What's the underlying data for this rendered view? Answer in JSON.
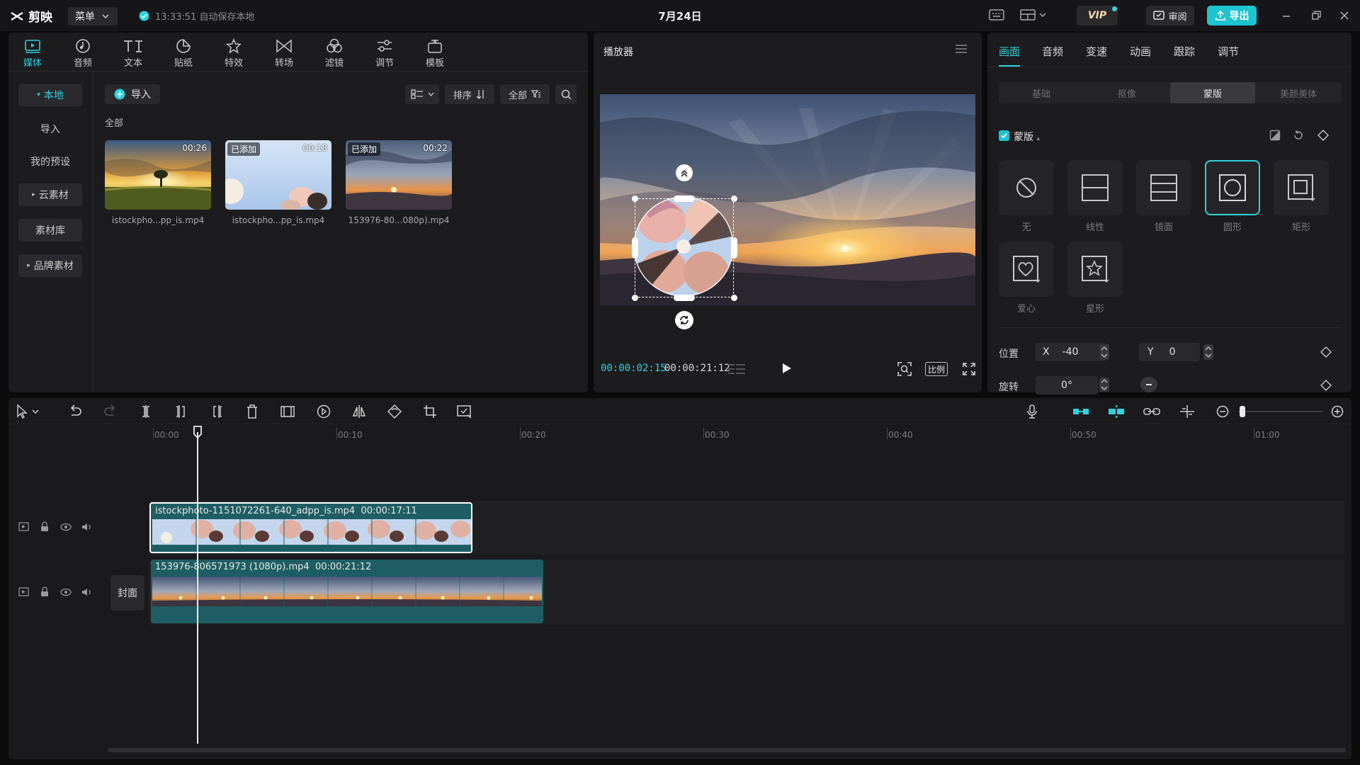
{
  "app": {
    "name": "剪映",
    "menu_label": "菜单",
    "autosave": "13:33:51 自动保存本地",
    "project_title": "7月24日",
    "vip_label": "VIP",
    "review_label": "审阅",
    "export_label": "导出"
  },
  "media_tools": [
    {
      "label": "媒体",
      "icon": "media-icon"
    },
    {
      "label": "音频",
      "icon": "audio-icon"
    },
    {
      "label": "文本",
      "icon": "text-icon"
    },
    {
      "label": "贴纸",
      "icon": "sticker-icon"
    },
    {
      "label": "特效",
      "icon": "effects-icon"
    },
    {
      "label": "转场",
      "icon": "transition-icon"
    },
    {
      "label": "滤镜",
      "icon": "filter-icon"
    },
    {
      "label": "调节",
      "icon": "adjust-icon"
    },
    {
      "label": "模板",
      "icon": "template-icon"
    }
  ],
  "sidebar": {
    "local": "本地",
    "import": "导入",
    "presets": "我的预设",
    "cloud": "云素材",
    "library": "素材库",
    "brand": "品牌素材"
  },
  "media": {
    "import_label": "导入",
    "sort_label": "排序",
    "filter_label": "全部",
    "all_label": "全部",
    "items": [
      {
        "name": "istockpho...pp_is.mp4",
        "duration": "00:26",
        "tag": ""
      },
      {
        "name": "istockpho...pp_is.mp4",
        "duration": "00:18",
        "tag": "已添加"
      },
      {
        "name": "153976-80...080p).mp4",
        "duration": "00:22",
        "tag": "已添加"
      }
    ]
  },
  "player": {
    "title": "播放器",
    "current_time": "00:00:02:15",
    "total_time": "00:00:21:12",
    "ratio_label": "比例"
  },
  "props": {
    "tabs": [
      "画面",
      "音频",
      "变速",
      "动画",
      "跟踪",
      "调节"
    ],
    "segments": [
      "基础",
      "抠像",
      "蒙版",
      "美颜美体"
    ],
    "mask_label": "蒙版",
    "masks": [
      "无",
      "线性",
      "镜面",
      "圆形",
      "矩形",
      "爱心",
      "星形"
    ],
    "position_label": "位置",
    "x_label": "X",
    "x_value": "-40",
    "y_label": "Y",
    "y_value": "0",
    "rotation_label": "旋转",
    "rotation_value": "0°"
  },
  "timeline": {
    "ruler": [
      "00:00",
      "00:10",
      "00:20",
      "00:30",
      "00:40",
      "00:50",
      "01:00"
    ],
    "cover_label": "封面",
    "clips": [
      {
        "label": "istockphoto-1151072261-640_adpp_is.mp4",
        "duration": "00:00:17:11"
      },
      {
        "label": "153976-806571973 (1080p).mp4",
        "duration": "00:00:21:12"
      }
    ]
  },
  "colors": {
    "accent": "#2ed1dc",
    "export": "#1ec4cf",
    "clip_teal": "#1e5e63"
  }
}
